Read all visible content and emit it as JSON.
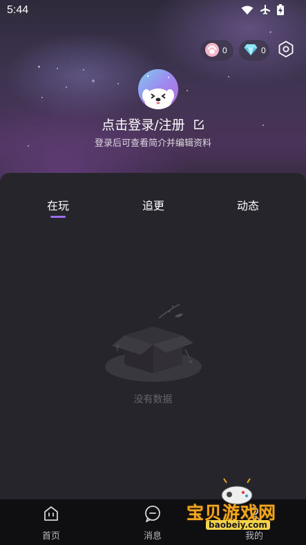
{
  "status_bar": {
    "time": "5:44",
    "icons": [
      "wifi-icon",
      "airplane-icon",
      "battery-charging-icon"
    ]
  },
  "top_chips": {
    "paw_count": "0",
    "diamond_count": "0"
  },
  "profile": {
    "login_title": "点击登录/注册",
    "login_subtitle": "登录后可查看简介并编辑资料"
  },
  "tabs": [
    {
      "label": "在玩",
      "active": true
    },
    {
      "label": "追更",
      "active": false
    },
    {
      "label": "动态",
      "active": false
    }
  ],
  "empty_state": {
    "text": "没有数据"
  },
  "bottom_nav": [
    {
      "label": "首页",
      "icon": "home-icon"
    },
    {
      "label": "消息",
      "icon": "message-icon"
    },
    {
      "label": "我的",
      "icon": "mine-icon"
    }
  ],
  "watermark": {
    "text": "宝贝游戏网",
    "url": "baobeiy.com"
  },
  "colors": {
    "accent": "#9d6df0",
    "panel": "#27252c",
    "nav_bg": "#0f0f12"
  }
}
